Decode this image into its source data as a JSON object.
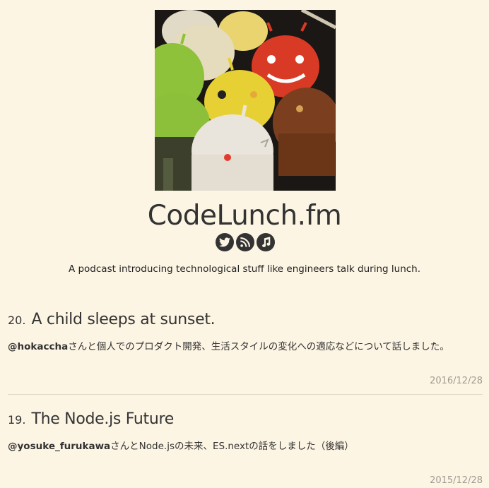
{
  "site": {
    "title": "CodeLunch.fm",
    "tagline": "A podcast introducing technological stuff like engineers talk during lunch."
  },
  "social": [
    {
      "icon": "twitter-icon"
    },
    {
      "icon": "rss-icon"
    },
    {
      "icon": "music-note-icon"
    }
  ],
  "episodes": [
    {
      "number": "20.",
      "title": "A child sleeps at sunset.",
      "guest": "@hokaccha",
      "description": "さんと個人でのプロダクト開発、生活スタイルの変化への適応などについて話しました。",
      "date": "2016/12/28"
    },
    {
      "number": "19.",
      "title": "The Node.js Future",
      "guest": "@yosuke_furukawa",
      "description": "さんとNode.jsの未来、ES.nextの話をしました（後編）",
      "date": "2015/12/28"
    }
  ],
  "colors": {
    "background": "#fdf5e4",
    "text": "#333333",
    "date": "#a09a92"
  }
}
